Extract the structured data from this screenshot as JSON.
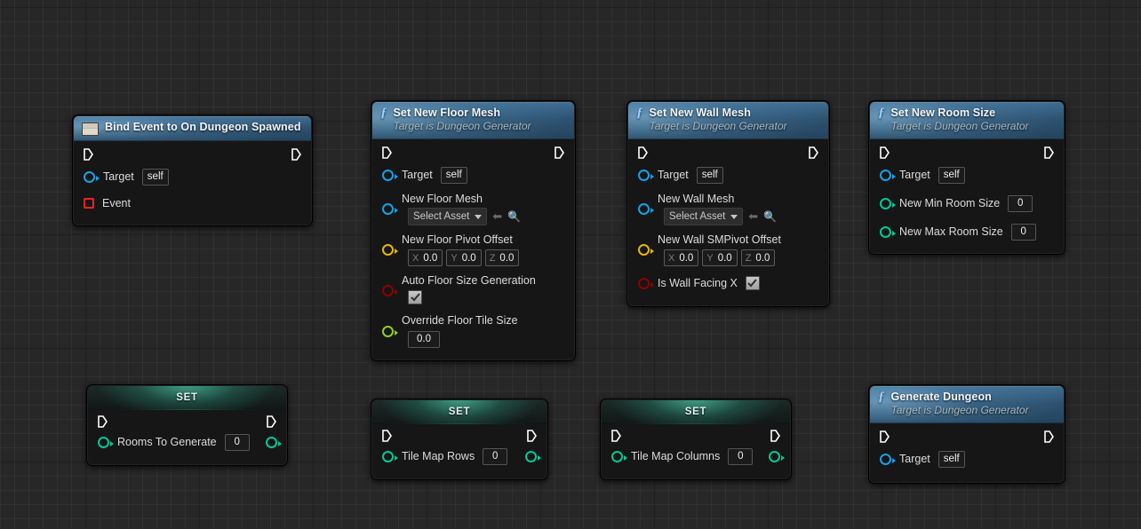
{
  "editor": {
    "name": "blueprint-event-graph",
    "background_color": "#272727",
    "grid_minor_color": "#2e2e2e",
    "grid_major_color": "#1a1a1a"
  },
  "pin_colors": {
    "exec": "#ffffff",
    "object": "#18a0e8",
    "vector": "#e5b700",
    "boolean": "#8c0000",
    "float": "#8ed020",
    "integer": "#00c896",
    "delegate": "#ff2020"
  },
  "nodes": [
    {
      "id": "bind-event-to-on-dungeon-spawned",
      "title": "Bind Event to On Dungeon Spawned",
      "subtitle": "",
      "header_icon": "delegate-icon",
      "header_type": "event",
      "exec_in": true,
      "exec_out": true,
      "pins": [
        {
          "label": "Target",
          "value": "self",
          "widget": "value-box",
          "color": "object",
          "shape": "circle"
        },
        {
          "label": "Event",
          "value": "",
          "widget": "none",
          "color": "delegate",
          "shape": "square"
        }
      ]
    },
    {
      "id": "set-new-floor-mesh",
      "title": "Set New Floor Mesh",
      "subtitle": "Target is Dungeon Generator",
      "header_icon": "function-icon",
      "header_type": "function",
      "exec_in": true,
      "exec_out": true,
      "pins": [
        {
          "label": "Target",
          "value": "self",
          "widget": "value-box",
          "color": "object",
          "shape": "circle"
        },
        {
          "label": "New Floor Mesh",
          "value": "Select Asset",
          "widget": "asset-picker",
          "color": "object",
          "shape": "circle"
        },
        {
          "label": "New Floor Pivot Offset",
          "widget": "vector",
          "color": "vector",
          "shape": "circle",
          "axes": [
            {
              "axis": "X",
              "value": "0.0"
            },
            {
              "axis": "Y",
              "value": "0.0"
            },
            {
              "axis": "Z",
              "value": "0.0"
            }
          ]
        },
        {
          "label": "Auto Floor Size Generation",
          "widget": "checkbox",
          "checked": true,
          "color": "boolean",
          "shape": "circle"
        },
        {
          "label": "Override Floor Tile Size",
          "value": "0.0",
          "widget": "value-box-below",
          "color": "float",
          "shape": "circle"
        }
      ]
    },
    {
      "id": "set-new-wall-mesh",
      "title": "Set New Wall Mesh",
      "subtitle": "Target is Dungeon Generator",
      "header_icon": "function-icon",
      "header_type": "function",
      "exec_in": true,
      "exec_out": true,
      "pins": [
        {
          "label": "Target",
          "value": "self",
          "widget": "value-box",
          "color": "object",
          "shape": "circle"
        },
        {
          "label": "New Wall Mesh",
          "value": "Select Asset",
          "widget": "asset-picker",
          "color": "object",
          "shape": "circle"
        },
        {
          "label": "New Wall SMPivot Offset",
          "widget": "vector",
          "color": "vector",
          "shape": "circle",
          "axes": [
            {
              "axis": "X",
              "value": "0.0"
            },
            {
              "axis": "Y",
              "value": "0.0"
            },
            {
              "axis": "Z",
              "value": "0.0"
            }
          ]
        },
        {
          "label": "Is Wall Facing X",
          "widget": "checkbox-inline",
          "checked": true,
          "color": "boolean",
          "shape": "circle"
        }
      ]
    },
    {
      "id": "set-new-room-size",
      "title": "Set New Room Size",
      "subtitle": "Target is Dungeon Generator",
      "header_icon": "function-icon",
      "header_type": "function",
      "exec_in": true,
      "exec_out": true,
      "pins": [
        {
          "label": "Target",
          "value": "self",
          "widget": "value-box",
          "color": "object",
          "shape": "circle"
        },
        {
          "label": "New Min Room Size",
          "value": "0",
          "widget": "value-box",
          "color": "integer",
          "shape": "circle"
        },
        {
          "label": "New Max Room Size",
          "value": "0",
          "widget": "value-box",
          "color": "integer",
          "shape": "circle"
        }
      ]
    },
    {
      "id": "set-rooms-to-generate",
      "title": "SET",
      "header_type": "set",
      "exec_in": true,
      "exec_out": true,
      "pins": [
        {
          "label": "Rooms To Generate",
          "value": "0",
          "widget": "value-box",
          "color": "integer",
          "shape": "circle",
          "has_output_pin": true
        }
      ]
    },
    {
      "id": "set-tile-map-rows",
      "title": "SET",
      "header_type": "set",
      "exec_in": true,
      "exec_out": true,
      "pins": [
        {
          "label": "Tile Map Rows",
          "value": "0",
          "widget": "value-box",
          "color": "integer",
          "shape": "circle",
          "has_output_pin": true
        }
      ]
    },
    {
      "id": "set-tile-map-columns",
      "title": "SET",
      "header_type": "set",
      "exec_in": true,
      "exec_out": true,
      "pins": [
        {
          "label": "Tile Map Columns",
          "value": "0",
          "widget": "value-box",
          "color": "integer",
          "shape": "circle",
          "has_output_pin": true
        }
      ]
    },
    {
      "id": "generate-dungeon",
      "title": "Generate Dungeon",
      "subtitle": "Target is Dungeon Generator",
      "header_icon": "function-icon",
      "header_type": "function",
      "exec_in": true,
      "exec_out": true,
      "pins": [
        {
          "label": "Target",
          "value": "self",
          "widget": "value-box",
          "color": "object",
          "shape": "circle"
        }
      ]
    }
  ]
}
